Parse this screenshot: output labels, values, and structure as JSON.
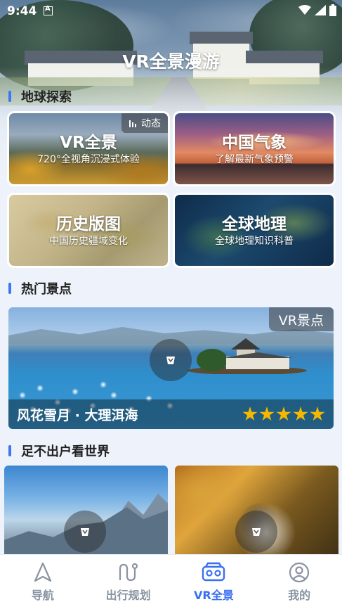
{
  "status_bar": {
    "time": "9:44"
  },
  "app": {
    "title": "VR全景漫游"
  },
  "sections": {
    "earth": "地球探索",
    "hot": "热门景点",
    "world": "足不出户看世界"
  },
  "features": [
    {
      "title": "VR全景",
      "subtitle": "720°全视角沉浸式体验",
      "tag": "动态"
    },
    {
      "title": "中国气象",
      "subtitle": "了解最新气象预警"
    },
    {
      "title": "历史版图",
      "subtitle": "中国历史疆域变化"
    },
    {
      "title": "全球地理",
      "subtitle": "全球地理知识科普"
    }
  ],
  "hot_spot": {
    "tag": "VR景点",
    "name": "风花雪月 · 大理洱海",
    "rating": 5
  },
  "nav": [
    {
      "label": "导航",
      "icon": "navigation-arrow-icon"
    },
    {
      "label": "出行规划",
      "icon": "route-icon"
    },
    {
      "label": "VR全景",
      "icon": "vr-headset-icon"
    },
    {
      "label": "我的",
      "icon": "profile-icon"
    }
  ],
  "colors": {
    "accent": "#3a6ff0",
    "star": "#f5b800",
    "nav_inactive": "#8a93a3"
  }
}
